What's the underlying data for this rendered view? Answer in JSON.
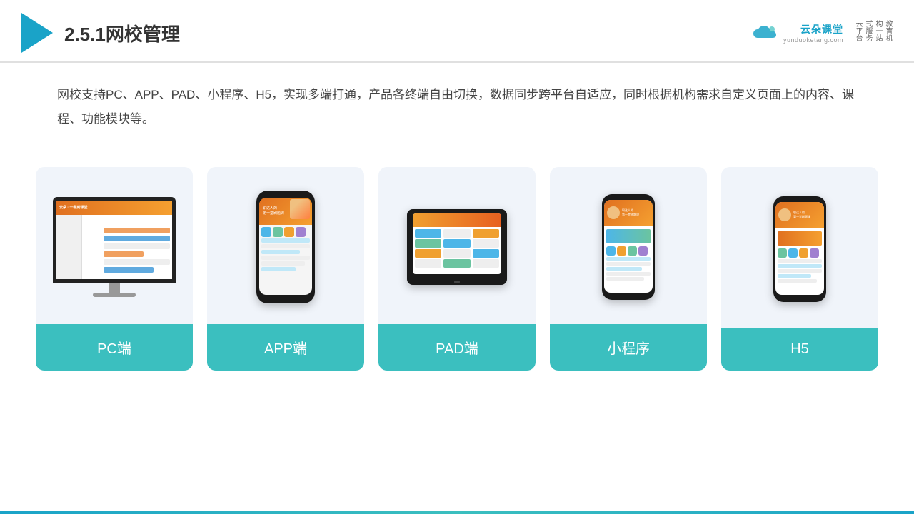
{
  "header": {
    "title": "2.5.1网校管理",
    "brand": {
      "name": "云朵课堂",
      "url": "yunduoketang.com",
      "slogan": "教育机构一站式服务云平台"
    }
  },
  "description": "网校支持PC、APP、PAD、小程序、H5，实现多端打通，产品各终端自由切换，数据同步跨平台自适应，同时根据机构需求自定义页面上的内容、课程、功能模块等。",
  "cards": [
    {
      "label": "PC端"
    },
    {
      "label": "APP端"
    },
    {
      "label": "PAD端"
    },
    {
      "label": "小程序"
    },
    {
      "label": "H5"
    }
  ]
}
